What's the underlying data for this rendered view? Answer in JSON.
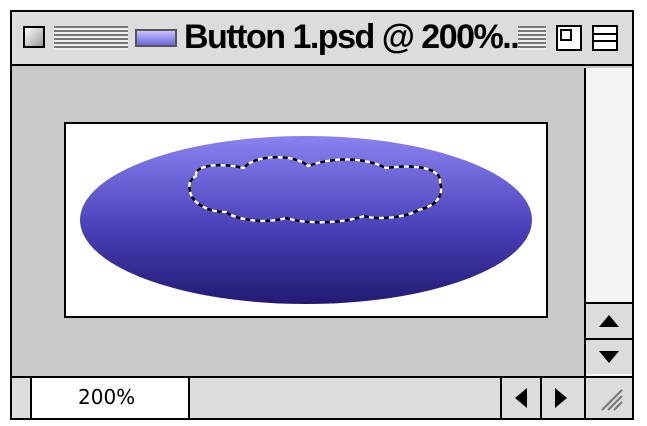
{
  "window": {
    "title": "Button 1.psd @ 200%...",
    "zoom_level": "200%"
  },
  "icons": {
    "close": "close-box-icon",
    "proxy": "document-proxy-icon",
    "zoom": "zoom-box-icon",
    "collapse": "collapse-box-icon",
    "scroll_up": "triangle-up-icon",
    "scroll_down": "triangle-down-icon",
    "scroll_left": "triangle-left-icon",
    "scroll_right": "triangle-right-icon",
    "resize": "resize-grip-icon"
  },
  "colors": {
    "ellipse_light": "#8a82f0",
    "ellipse_dark": "#221a72",
    "window_gray": "#c9c9c9"
  }
}
